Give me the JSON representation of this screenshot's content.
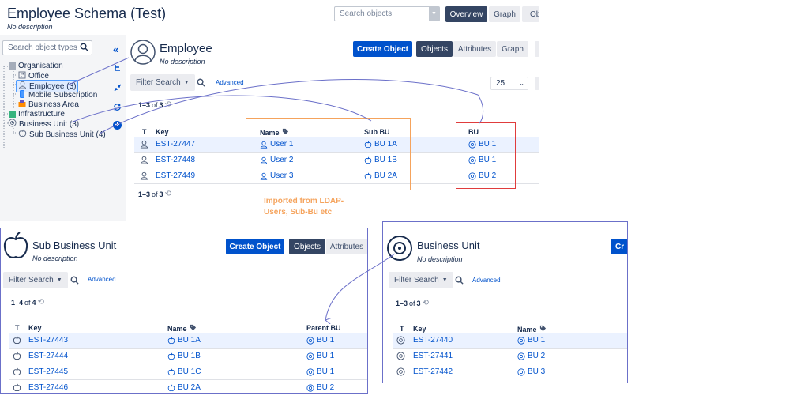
{
  "header": {
    "title": "Employee Schema (Test)",
    "subtitle": "No description",
    "search_placeholder": "Search objects",
    "tab_overview": "Overview",
    "tab_graph": "Graph",
    "tab_cut": "Ob"
  },
  "sidebar": {
    "search_placeholder": "Search object types",
    "items": [
      {
        "label": "Organisation"
      },
      {
        "label": "Office"
      },
      {
        "label": "Employee (3)"
      },
      {
        "label": "Mobile Subscription"
      },
      {
        "label": "Business Area"
      },
      {
        "label": "Infrastructure"
      },
      {
        "label": "Business Unit (3)"
      },
      {
        "label": "Sub Business Unit (4)"
      }
    ]
  },
  "employee": {
    "title": "Employee",
    "subtitle": "No description",
    "create": "Create Object",
    "tab_objects": "Objects",
    "tab_attributes": "Attributes",
    "tab_graph": "Graph",
    "filter": "Filter Search",
    "advanced": "Advanced",
    "page_size": "25",
    "count_range": "1–3",
    "count_of": "of",
    "count_total": "3",
    "col_t": "T",
    "col_key": "Key",
    "col_name": "Name",
    "col_subbu": "Sub BU",
    "col_bu": "BU",
    "rows": [
      {
        "key": "EST-27447",
        "name": "User 1",
        "subbu": "BU 1A",
        "bu": "BU 1"
      },
      {
        "key": "EST-27448",
        "name": "User 2",
        "subbu": "BU 1B",
        "bu": "BU 1"
      },
      {
        "key": "EST-27449",
        "name": "User 3",
        "subbu": "BU 2A",
        "bu": "BU 2"
      }
    ],
    "annotation": "Imported from LDAP-\nUsers, Sub-Bu etc"
  },
  "subbu": {
    "title": "Sub Business Unit",
    "subtitle": "No description",
    "create": "Create Object",
    "tab_objects": "Objects",
    "tab_attributes": "Attributes",
    "filter": "Filter Search",
    "advanced": "Advanced",
    "count_range": "1–4",
    "count_of": "of",
    "count_total": "4",
    "col_t": "T",
    "col_key": "Key",
    "col_name": "Name",
    "col_parent": "Parent BU",
    "rows": [
      {
        "key": "EST-27443",
        "name": "BU 1A",
        "parent": "BU 1"
      },
      {
        "key": "EST-27444",
        "name": "BU 1B",
        "parent": "BU 1"
      },
      {
        "key": "EST-27445",
        "name": "BU 1C",
        "parent": "BU 1"
      },
      {
        "key": "EST-27446",
        "name": "BU 2A",
        "parent": "BU 2"
      }
    ]
  },
  "bu": {
    "title": "Business Unit",
    "subtitle": "No description",
    "create_cut": "Cr",
    "filter": "Filter Search",
    "advanced": "Advanced",
    "count_range": "1–3",
    "count_of": "of",
    "count_total": "3",
    "col_t": "T",
    "col_key": "Key",
    "col_name": "Name",
    "rows": [
      {
        "key": "EST-27440",
        "name": "BU 1"
      },
      {
        "key": "EST-27441",
        "name": "BU 2"
      },
      {
        "key": "EST-27442",
        "name": "BU 3"
      }
    ]
  },
  "colors": {
    "accent": "#0052cc",
    "dark": "#344563",
    "annotation": "#f5a35c",
    "bu_box": "#e03c3c",
    "panel_border": "#6b70c9"
  }
}
